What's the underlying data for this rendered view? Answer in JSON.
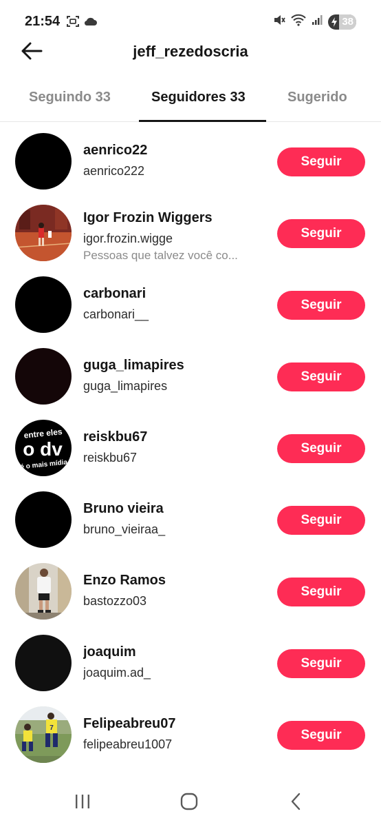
{
  "status_bar": {
    "time": "21:54",
    "battery_level": "38",
    "left_icons": [
      "screenshot-icon",
      "cloud-icon"
    ],
    "right_icons": [
      "mute-icon",
      "wifi-icon",
      "signal-icon",
      "battery-icon"
    ]
  },
  "header": {
    "title": "jeff_rezedoscria",
    "back_icon": "arrow-left-icon"
  },
  "tabs": [
    {
      "label": "Seguindo 33",
      "active": false
    },
    {
      "label": "Seguidores 33",
      "active": true
    },
    {
      "label": "Sugerido",
      "active": false
    }
  ],
  "followers": [
    {
      "name": "aenrico22",
      "handle": "aenrico222",
      "note": "",
      "button": "Seguir",
      "avatar": "black"
    },
    {
      "name": "Igor Frozin Wiggers",
      "handle": "igor.frozin.wigge",
      "note": "Pessoas que talvez você co...",
      "button": "Seguir",
      "avatar": "futsal-photo"
    },
    {
      "name": "carbonari",
      "handle": "carbonari__",
      "note": "",
      "button": "Seguir",
      "avatar": "black"
    },
    {
      "name": "guga_limapires",
      "handle": "guga_limapires",
      "note": "",
      "button": "Seguir",
      "avatar": "dark-photo"
    },
    {
      "name": "reiskbu67",
      "handle": "reiskbu67",
      "note": "",
      "button": "Seguir",
      "avatar": "text-logo"
    },
    {
      "name": "Bruno vieira",
      "handle": "bruno_vieiraa_",
      "note": "",
      "button": "Seguir",
      "avatar": "black"
    },
    {
      "name": "Enzo Ramos",
      "handle": "bastozzo03",
      "note": "",
      "button": "Seguir",
      "avatar": "player-photo"
    },
    {
      "name": "joaquim",
      "handle": "joaquim.ad_",
      "note": "",
      "button": "Seguir",
      "avatar": "dark-photo"
    },
    {
      "name": "Felipeabreu07",
      "handle": "felipeabreu1007",
      "note": "",
      "button": "Seguir",
      "avatar": "soccer-photo"
    }
  ],
  "avatar_text": {
    "line1": "entre eles",
    "line2": "o dv",
    "line3": "é o mais mídia"
  },
  "nav_bar": {
    "icons": [
      "recent-apps-icon",
      "home-icon",
      "back-icon"
    ]
  },
  "colors": {
    "accent": "#fe2c55",
    "text_primary": "#161616",
    "text_secondary": "#8a8a8a",
    "divider": "#e6e6e6"
  }
}
